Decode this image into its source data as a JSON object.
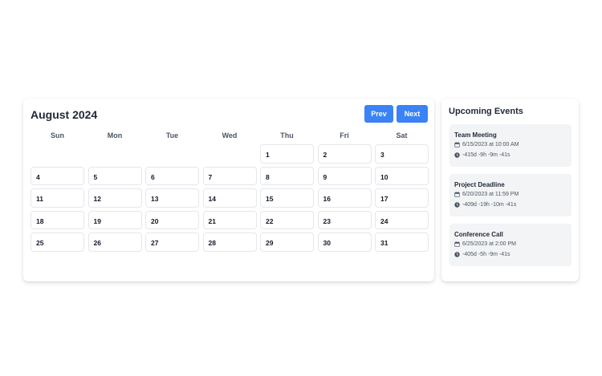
{
  "calendar": {
    "title": "August 2024",
    "prev_label": "Prev",
    "next_label": "Next",
    "weekdays": [
      "Sun",
      "Mon",
      "Tue",
      "Wed",
      "Thu",
      "Fri",
      "Sat"
    ],
    "leading_blanks": 4,
    "days": [
      "1",
      "2",
      "3",
      "4",
      "5",
      "6",
      "7",
      "8",
      "9",
      "10",
      "11",
      "12",
      "13",
      "14",
      "15",
      "16",
      "17",
      "18",
      "19",
      "20",
      "21",
      "22",
      "23",
      "24",
      "25",
      "26",
      "27",
      "28",
      "29",
      "30",
      "31"
    ]
  },
  "events_panel": {
    "title": "Upcoming Events",
    "events": [
      {
        "name": "Team Meeting",
        "datetime": "6/15/2023 at 10:00 AM",
        "countdown": "-415d -9h -9m -41s"
      },
      {
        "name": "Project Deadline",
        "datetime": "6/20/2023 at 11:59 PM",
        "countdown": "-409d -19h -10m -41s"
      },
      {
        "name": "Conference Call",
        "datetime": "6/25/2023 at 2:00 PM",
        "countdown": "-405d -5h -9m -41s"
      }
    ]
  },
  "colors": {
    "accent": "#3b82f6",
    "event_bg": "#f3f4f6",
    "text": "#1f2937",
    "muted": "#4b5563"
  },
  "icons": {
    "date": "calendar-icon",
    "countdown": "clock-icon"
  }
}
